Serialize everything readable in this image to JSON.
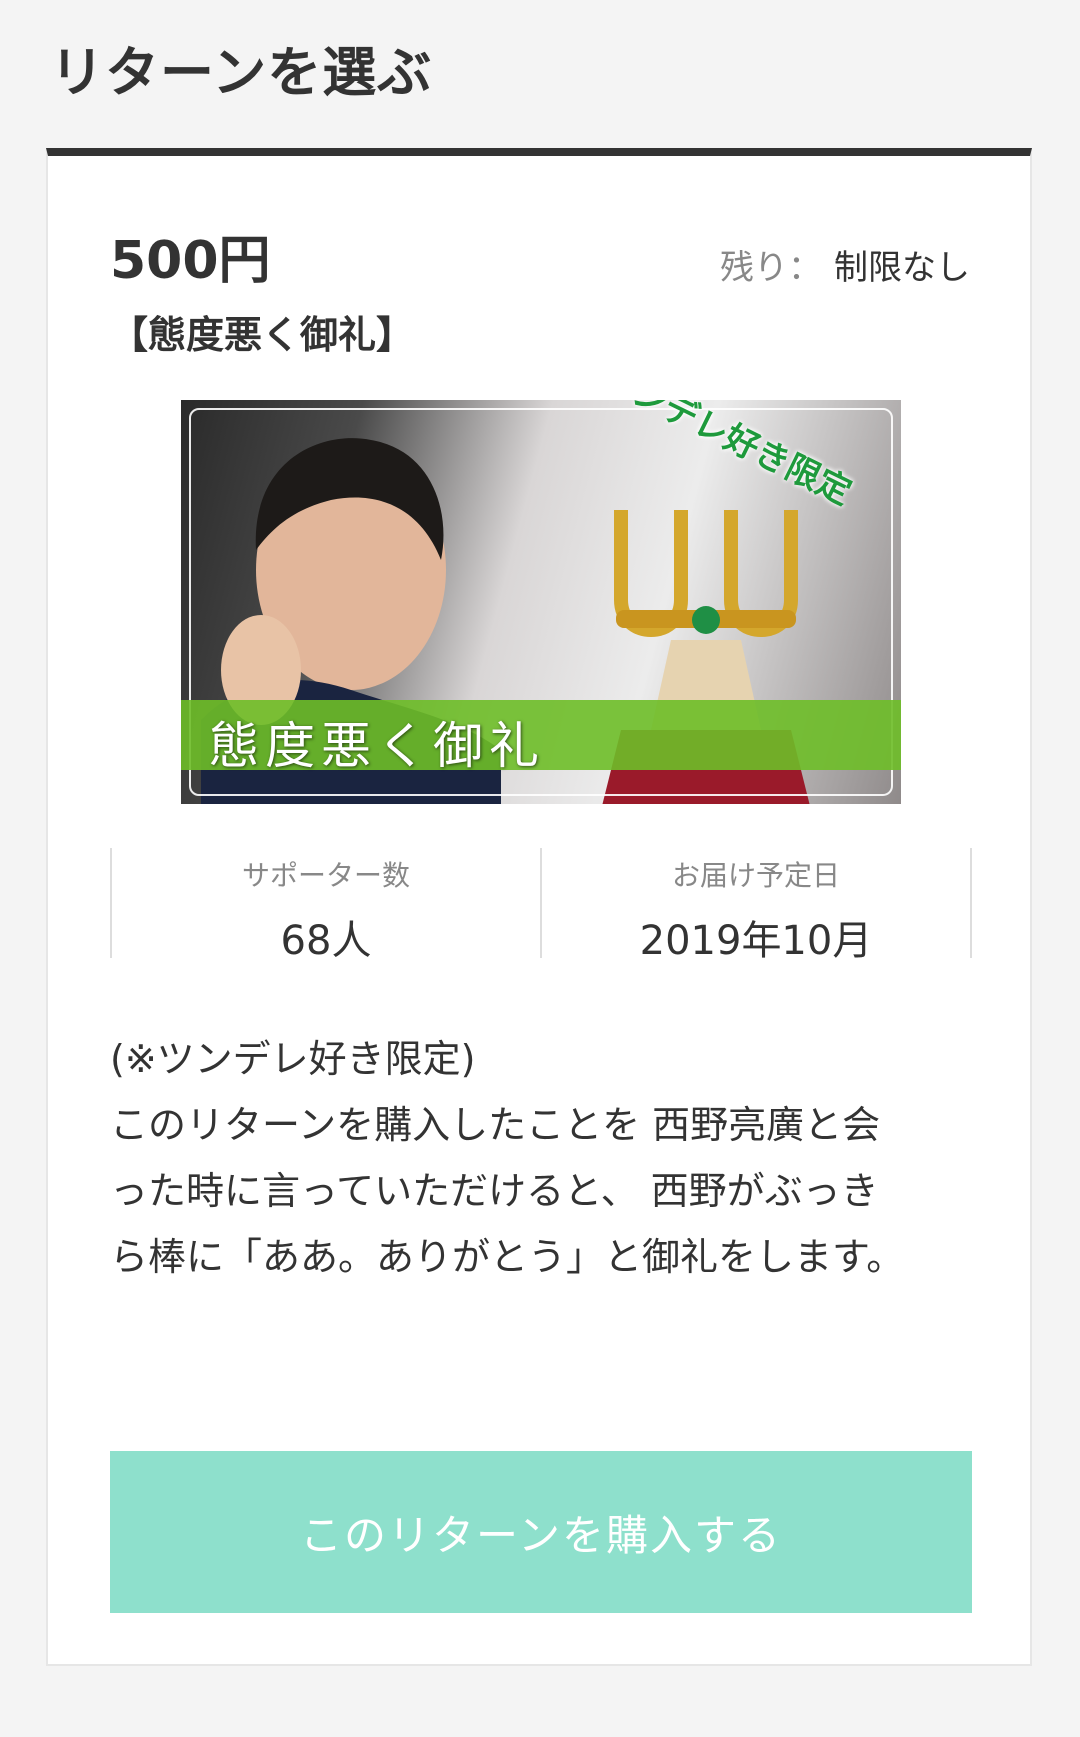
{
  "page": {
    "title": "リターンを選ぶ"
  },
  "return_card": {
    "price": "500円",
    "remaining_label": "残り：",
    "remaining_value": "制限なし",
    "title": "【態度悪く御礼】",
    "image": {
      "corner_text": "ツンデレ好き限定",
      "band_text": "態度悪く御礼"
    },
    "stats": {
      "supporters_label": "サポーター数",
      "supporters_value": "68人",
      "delivery_label": "お届け予定日",
      "delivery_value": "2019年10月"
    },
    "description": [
      "(※ツンデレ好き限定)",
      "このリターンを購入したことを 西野亮廣と会",
      "った時に言っていただけると、 西野がぶっき",
      "ら棒に「ああ。ありがとう」と御礼をします。"
    ],
    "buy_button_label": "このリターンを購入する"
  },
  "colors": {
    "page_background": "#f4f4f4",
    "card_top_border": "#333333",
    "buy_button": "#8ee0cc",
    "image_band": "#6ebe28",
    "corner_text": "#1e9a3c"
  }
}
